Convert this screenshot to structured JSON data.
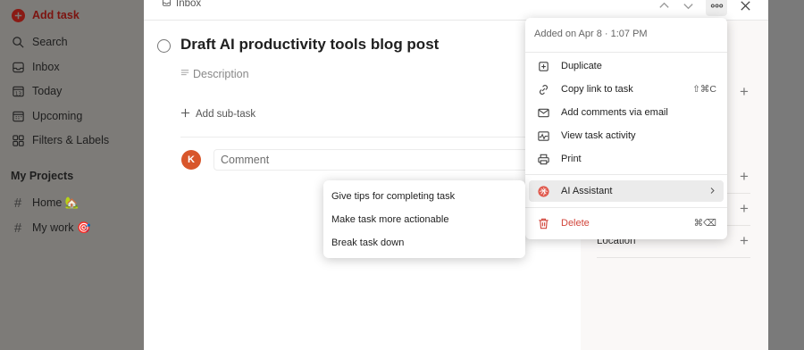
{
  "sidebar": {
    "add_task": "Add task",
    "items": [
      {
        "label": "Search",
        "icon": "search-icon"
      },
      {
        "label": "Inbox",
        "icon": "inbox-icon"
      },
      {
        "label": "Today",
        "icon": "calendar-today-icon"
      },
      {
        "label": "Upcoming",
        "icon": "calendar-upcoming-icon"
      },
      {
        "label": "Filters & Labels",
        "icon": "filters-icon"
      }
    ],
    "projects_heading": "My Projects",
    "projects": [
      {
        "label": "Home 🏡"
      },
      {
        "label": "My work 🎯"
      }
    ]
  },
  "task": {
    "breadcrumb": "Inbox",
    "title": "Draft AI productivity tools blog post",
    "description_placeholder": "Description",
    "add_subtask": "Add sub-task",
    "comment_placeholder": "Comment",
    "avatar_initial": "K"
  },
  "right_pane": {
    "location_label": "Location"
  },
  "menu": {
    "header": "Added on Apr 8 · 1:07 PM",
    "items": [
      {
        "label": "Duplicate",
        "icon": "duplicate-icon"
      },
      {
        "label": "Copy link to task",
        "icon": "link-icon",
        "shortcut": "⇧⌘C"
      },
      {
        "label": "Add comments via email",
        "icon": "email-icon"
      },
      {
        "label": "View task activity",
        "icon": "activity-icon"
      },
      {
        "label": "Print",
        "icon": "print-icon"
      }
    ],
    "ai_assistant": "AI Assistant",
    "delete": "Delete",
    "delete_shortcut": "⌘⌫"
  },
  "submenu": {
    "items": [
      {
        "label": "Give tips for completing task"
      },
      {
        "label": "Make task more actionable"
      },
      {
        "label": "Break task down"
      }
    ]
  },
  "colors": {
    "brand_red": "#dc4c3e",
    "danger": "#d1453b",
    "avatar": "#d8562b"
  }
}
